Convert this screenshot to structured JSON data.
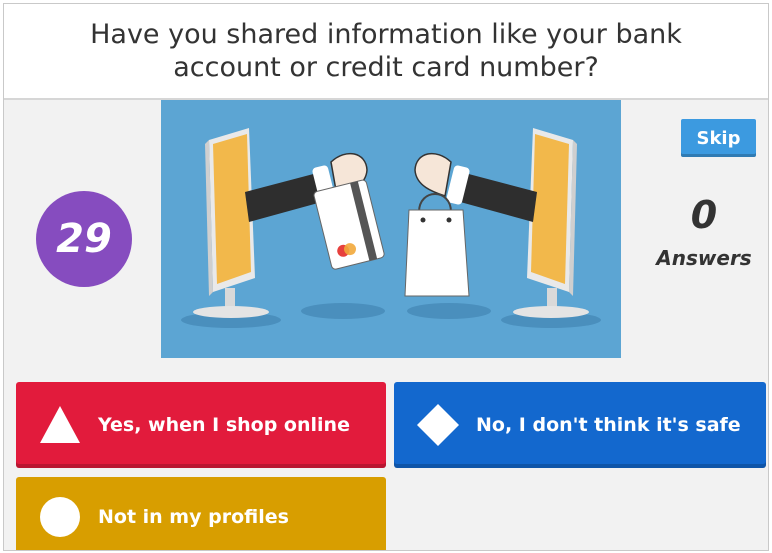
{
  "question": {
    "text": "Have you shared information like your bank account or credit card number?"
  },
  "timer": {
    "value": "29"
  },
  "skip_button": {
    "label": "Skip"
  },
  "answers_counter": {
    "count": "0",
    "label": "Answers"
  },
  "media": {
    "description_icon": "online-shopping-illustration"
  },
  "answers": [
    {
      "label": "Yes, when I shop online",
      "shape": "triangle-icon",
      "color": "#e21b3c"
    },
    {
      "label": "No, I don't think it's safe",
      "shape": "diamond-icon",
      "color": "#1368ce"
    },
    {
      "label": "Not in my profiles",
      "shape": "circle-icon",
      "color": "#d89e00"
    }
  ],
  "colors": {
    "timer": "#864cbf",
    "skip": "#3c9ae0",
    "media_bg": "#5ca5d3"
  }
}
